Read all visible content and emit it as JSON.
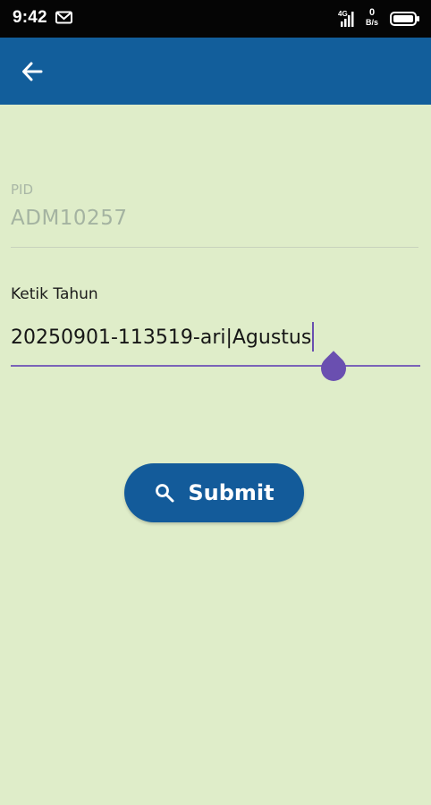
{
  "status_bar": {
    "time": "9:42",
    "network_speed_value": "0",
    "network_speed_unit": "B/s",
    "icons": [
      "gmail-icon",
      "signal-icon",
      "battery-icon"
    ]
  },
  "app_bar": {
    "back_icon": "arrow-left-icon",
    "color": "#125e9b"
  },
  "form": {
    "pid": {
      "label": "PID",
      "value": "ADM10257"
    },
    "year_field": {
      "label": "Ketik Tahun",
      "value": "20250901-113519-ari|Agustus"
    },
    "submit": {
      "label": "Submit",
      "icon": "search-icon"
    }
  },
  "colors": {
    "background": "#dfedc9",
    "accent": "#125e9b",
    "caret": "#6a4fb0"
  }
}
